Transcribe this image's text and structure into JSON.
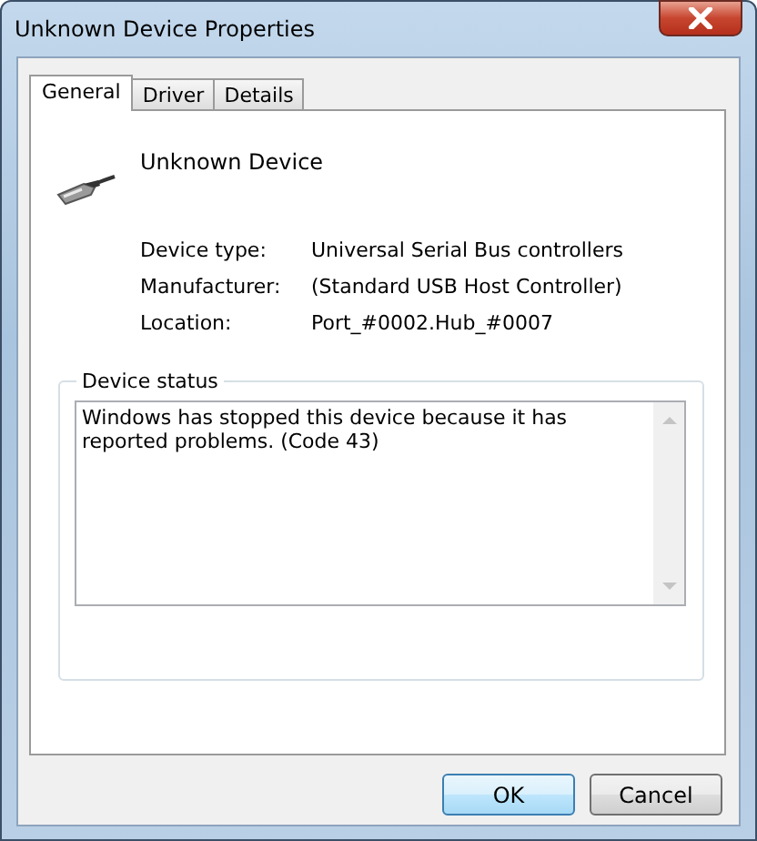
{
  "window": {
    "title": "Unknown Device Properties"
  },
  "tabs": [
    {
      "label": "General",
      "selected": true
    },
    {
      "label": "Driver",
      "selected": false
    },
    {
      "label": "Details",
      "selected": false
    }
  ],
  "device": {
    "name": "Unknown Device"
  },
  "properties": [
    {
      "label": "Device type:",
      "value": "Universal Serial Bus controllers"
    },
    {
      "label": "Manufacturer:",
      "value": "(Standard USB Host Controller)"
    },
    {
      "label": "Location:",
      "value": "Port_#0002.Hub_#0007"
    }
  ],
  "device_status": {
    "title": "Device status",
    "text": "Windows has stopped this device because it has reported problems. (Code 43)"
  },
  "buttons": [
    {
      "label": "OK",
      "default": true
    },
    {
      "label": "Cancel",
      "default": false
    }
  ]
}
